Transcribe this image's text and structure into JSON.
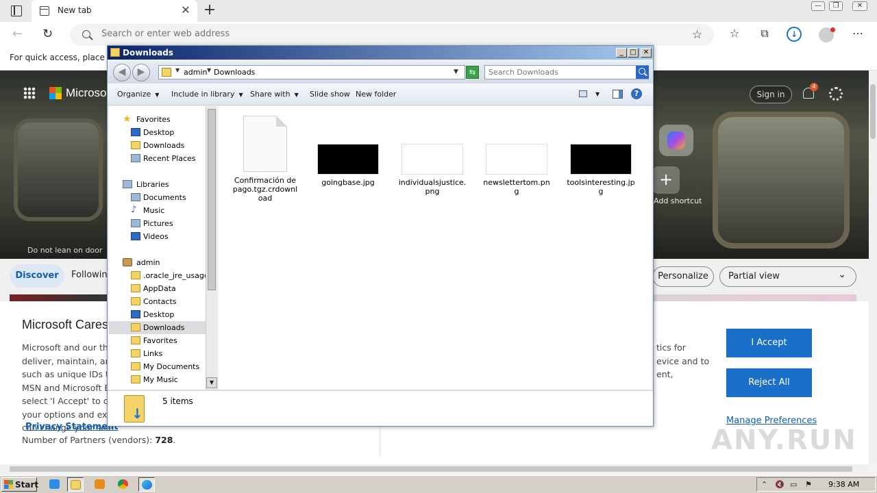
{
  "browser": {
    "tab_title": "New tab",
    "tab_close": "✕",
    "newtab": "+",
    "address_placeholder": "Search or enter web address",
    "quick_access_text": "For quick access, place your"
  },
  "ntp": {
    "brand": "Microsoft",
    "signin": "Sign in",
    "notifications_count": "4",
    "add_shortcut": "Add shortcut",
    "hero_caption": "Do not lean on door",
    "tabs": {
      "discover": "Discover",
      "following": "Following"
    },
    "personalize": "Personalize",
    "view_select": "Partial view"
  },
  "consent": {
    "title": "Microsoft Cares About Your Privacy",
    "lines": [
      "Microsoft and our third parties use cookies and similar technologies to deliver, maintain, and improve our services and ads.",
      "such as unique IDs to",
      "MSN and Microsoft E",
      "select 'I Accept' to co",
      "your options and exe",
      "can change your sele"
    ],
    "right_lines": [
      "tics for",
      "evice and to",
      "ent,"
    ],
    "privacy_link": "Privacy Statement",
    "partners_label": "Number of Partners (vendors):",
    "partners_count": "728",
    "accept": "I Accept",
    "reject": "Reject All",
    "manage": "Manage Preferences"
  },
  "watermark": "ANY.RUN",
  "explorer": {
    "title": "Downloads",
    "path": [
      "admin",
      "Downloads"
    ],
    "search_placeholder": "Search Downloads",
    "commands": [
      "Organize",
      "Include in library",
      "Share with",
      "Slide show",
      "New folder"
    ],
    "nav": [
      {
        "label": "Favorites"
      },
      {
        "label": "Desktop"
      },
      {
        "label": "Downloads"
      },
      {
        "label": "Recent Places"
      },
      {
        "label": "Libraries"
      },
      {
        "label": "Documents"
      },
      {
        "label": "Music"
      },
      {
        "label": "Pictures"
      },
      {
        "label": "Videos"
      },
      {
        "label": "admin"
      },
      {
        "label": ".oracle_jre_usage"
      },
      {
        "label": "AppData"
      },
      {
        "label": "Contacts"
      },
      {
        "label": "Desktop"
      },
      {
        "label": "Downloads"
      },
      {
        "label": "Favorites"
      },
      {
        "label": "Links"
      },
      {
        "label": "My Documents"
      },
      {
        "label": "My Music"
      }
    ],
    "files": [
      {
        "name": "Confirmación de pago.tgz.crdownload",
        "thumb": "document"
      },
      {
        "name": "goingbase.jpg",
        "thumb": "black",
        "color": "#000000"
      },
      {
        "name": "individualsjustice.png",
        "thumb": "white",
        "color": "#ffffff"
      },
      {
        "name": "newslettertom.png",
        "thumb": "white",
        "color": "#ffffff"
      },
      {
        "name": "toolsinteresting.jpg",
        "thumb": "black",
        "color": "#000000"
      }
    ],
    "item_count": "5 items"
  },
  "taskbar": {
    "start": "Start",
    "clock": "9:38 AM"
  },
  "colors": {
    "accent": "#1a6fc9",
    "explorer_title": "#0a246a"
  }
}
